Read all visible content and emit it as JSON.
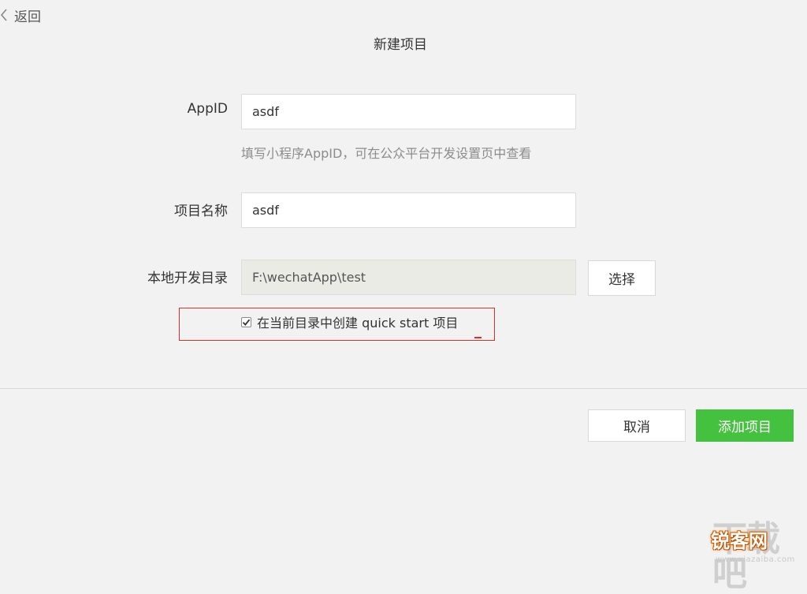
{
  "header": {
    "back_label": "返回",
    "back_icon": "chevron-left-icon",
    "title": "新建项目"
  },
  "form": {
    "appid": {
      "label": "AppID",
      "value": "asdf",
      "hint": "填写小程序AppID，可在公众平台开发设置页中查看"
    },
    "project_name": {
      "label": "项目名称",
      "value": "asdf"
    },
    "local_dir": {
      "label": "本地开发目录",
      "value": "F:\\wechatApp\\test",
      "choose_label": "选择"
    },
    "quickstart": {
      "checked": true,
      "label": "在当前目录中创建 quick start 项目"
    }
  },
  "footer": {
    "cancel_label": "取消",
    "add_label": "添加项目"
  },
  "watermark": {
    "logo_text": "下载吧",
    "brand_text": "锐客网",
    "url_text": "www.xiazaiba.com"
  },
  "colors": {
    "background": "#f2f2f2",
    "primary_green": "#44c13f",
    "highlight_red": "#d8302a",
    "hint_gray": "#8c8c8c"
  }
}
